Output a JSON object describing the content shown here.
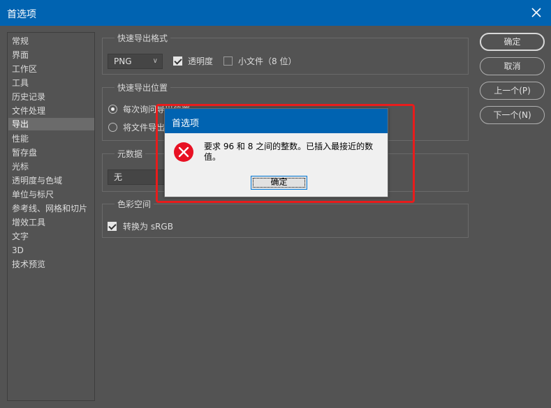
{
  "window": {
    "title": "首选项"
  },
  "sidebar": {
    "items": [
      {
        "label": "常规"
      },
      {
        "label": "界面"
      },
      {
        "label": "工作区"
      },
      {
        "label": "工具"
      },
      {
        "label": "历史记录"
      },
      {
        "label": "文件处理"
      },
      {
        "label": "导出",
        "active": true
      },
      {
        "label": "性能"
      },
      {
        "label": "暂存盘"
      },
      {
        "label": "光标"
      },
      {
        "label": "透明度与色域"
      },
      {
        "label": "单位与标尺"
      },
      {
        "label": "参考线、网格和切片"
      },
      {
        "label": "增效工具"
      },
      {
        "label": "文字"
      },
      {
        "label": "3D"
      },
      {
        "label": "技术预览"
      }
    ]
  },
  "quick_export_format": {
    "legend": "快速导出格式",
    "format_value": "PNG",
    "transparency_label": "透明度",
    "transparency_checked": true,
    "small_file_label": "小文件（8 位）",
    "small_file_checked": false
  },
  "quick_export_location": {
    "legend": "快速导出位置",
    "option1_label": "每次询问导出位置",
    "option2_label": "将文件导出到当前文档旁边的资源文件夹",
    "selected": "option1"
  },
  "metadata": {
    "legend": "元数据",
    "value": "无"
  },
  "color_space": {
    "legend": "色彩空间",
    "convert_label": "转换为 sRGB",
    "convert_checked": true
  },
  "buttons": {
    "ok": "确定",
    "cancel": "取消",
    "prev": "上一个(P)",
    "next": "下一个(N)"
  },
  "modal": {
    "title": "首选项",
    "message": "要求 96 和 8 之间的整数。已插入最接近的数值。",
    "ok_label": "确定"
  },
  "colors": {
    "titlebar": "#0063b1",
    "panel": "#535353",
    "highlight": "#e81c1c",
    "error_icon": "#e81123"
  }
}
